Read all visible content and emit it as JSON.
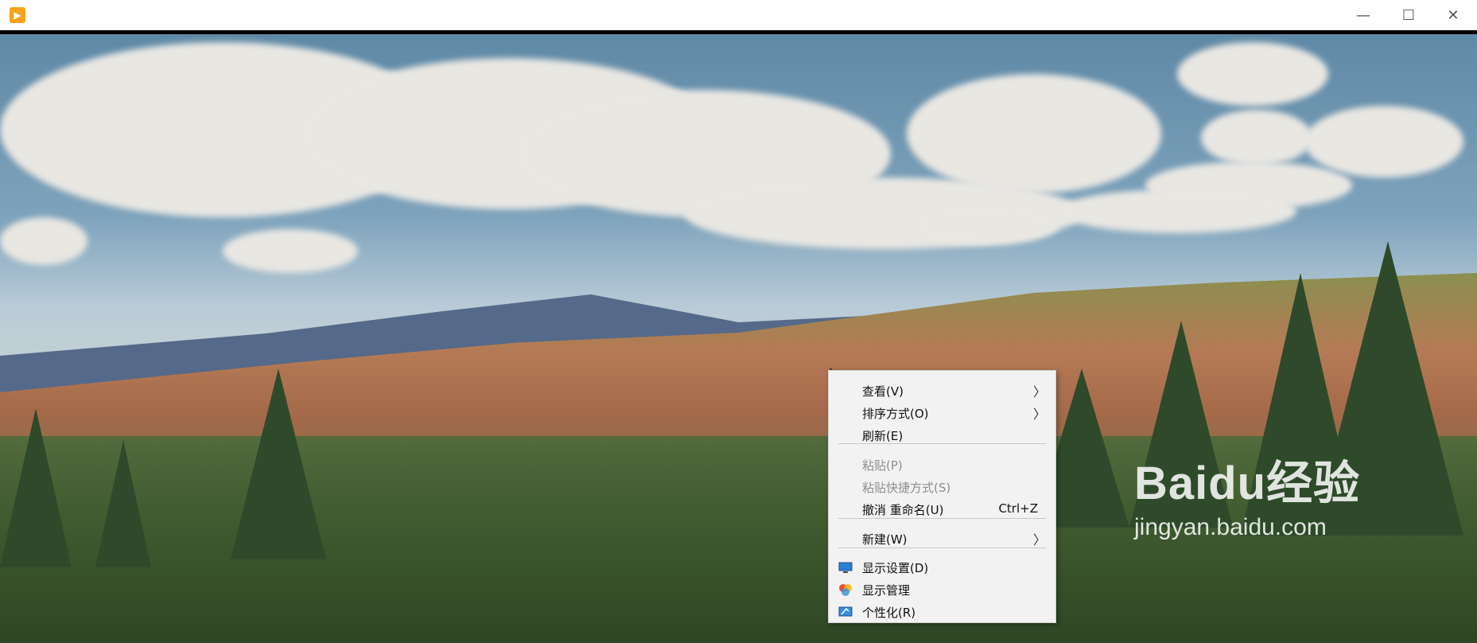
{
  "window": {
    "app_icon": "media-player-icon",
    "controls": {
      "minimize": "—",
      "maximize": "☐",
      "close": "✕"
    }
  },
  "context_menu": {
    "items": [
      {
        "label": "查看(V)",
        "submenu": true,
        "enabled": true
      },
      {
        "label": "排序方式(O)",
        "submenu": true,
        "enabled": true
      },
      {
        "label": "刷新(E)",
        "submenu": false,
        "enabled": true
      },
      {
        "label": "粘贴(P)",
        "submenu": false,
        "enabled": false
      },
      {
        "label": "粘贴快捷方式(S)",
        "submenu": false,
        "enabled": false
      },
      {
        "label": "撤消 重命名(U)",
        "shortcut": "Ctrl+Z",
        "submenu": false,
        "enabled": true
      },
      {
        "label": "新建(W)",
        "submenu": true,
        "enabled": true
      },
      {
        "label": "显示设置(D)",
        "icon": "display-settings-icon",
        "submenu": false,
        "enabled": true
      },
      {
        "label": "显示管理",
        "icon": "display-manager-icon",
        "submenu": false,
        "enabled": true
      },
      {
        "label": "个性化(R)",
        "icon": "personalize-icon",
        "submenu": false,
        "enabled": true
      }
    ],
    "submenu_arrow": "〉"
  },
  "watermark": {
    "brand": "Baidu经验",
    "url": "jingyan.baidu.com"
  }
}
